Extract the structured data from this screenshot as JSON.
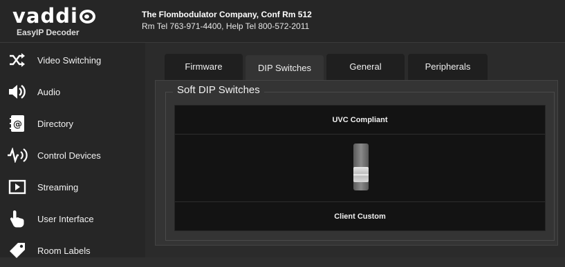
{
  "header": {
    "logo_text": "vaddi",
    "product_name": "EasyIP Decoder",
    "room_line": "The Flombodulator Company, Conf Rm 512",
    "tel_line": "Rm Tel 763-971-4400, Help Tel 800-572-2011"
  },
  "sidebar": {
    "items": [
      {
        "label": "Video Switching",
        "icon": "shuffle-icon"
      },
      {
        "label": "Audio",
        "icon": "speaker-icon"
      },
      {
        "label": "Directory",
        "icon": "address-book-icon"
      },
      {
        "label": "Control Devices",
        "icon": "control-signal-icon"
      },
      {
        "label": "Streaming",
        "icon": "play-icon"
      },
      {
        "label": "User Interface",
        "icon": "pointer-hand-icon"
      },
      {
        "label": "Room Labels",
        "icon": "tag-icon"
      }
    ]
  },
  "tabs": [
    {
      "label": "Firmware"
    },
    {
      "label": "DIP Switches",
      "active": true
    },
    {
      "label": "General"
    },
    {
      "label": "Peripherals"
    }
  ],
  "panel": {
    "legend": "Soft DIP Switches",
    "switch": {
      "top_label": "UVC Compliant",
      "bottom_label": "Client Custom"
    }
  }
}
